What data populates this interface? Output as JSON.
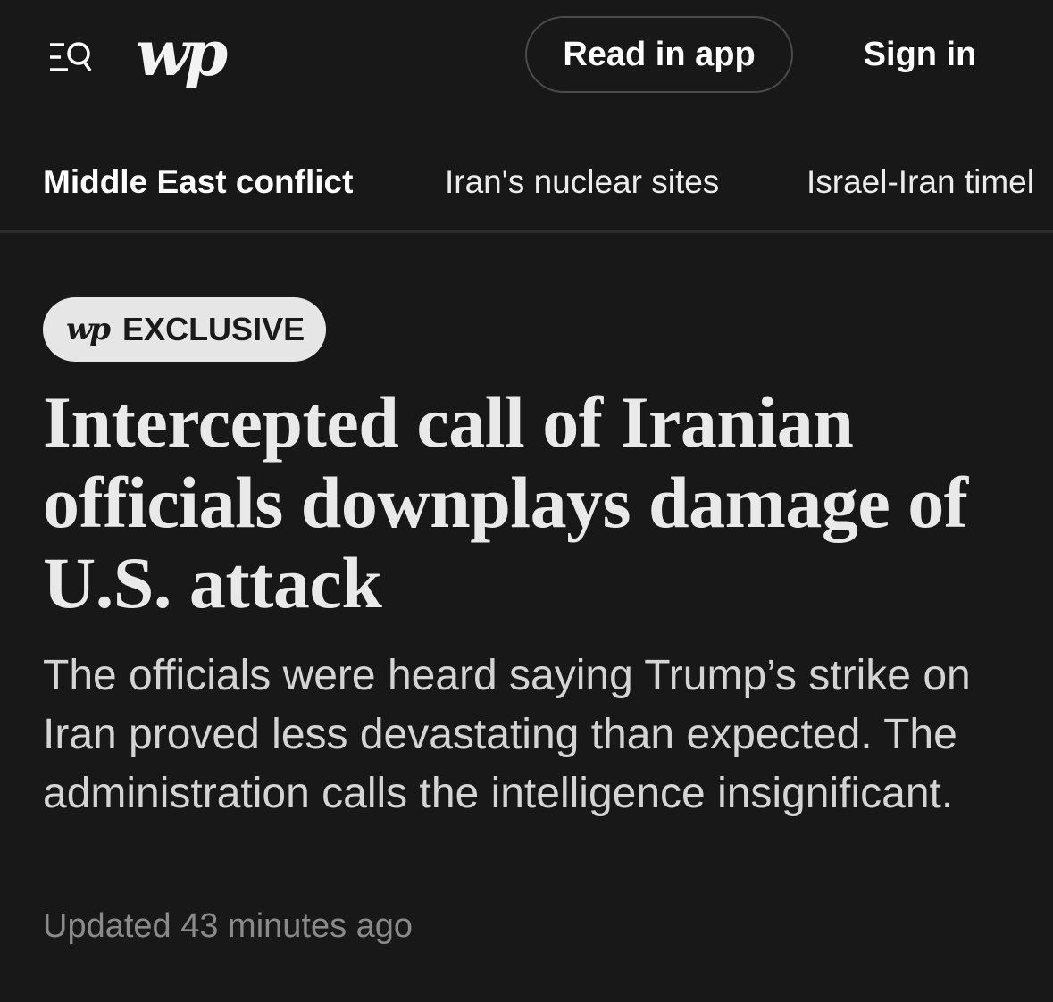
{
  "header": {
    "menu_search_icon": "menu-search-icon",
    "logo_text": "wp",
    "read_in_app_label": "Read in app",
    "sign_in_label": "Sign in"
  },
  "topic_nav": {
    "items": [
      {
        "label": "Middle East conflict",
        "active": true
      },
      {
        "label": "Iran's nuclear sites",
        "active": false
      },
      {
        "label": "Israel-Iran timel",
        "active": false
      }
    ]
  },
  "article": {
    "badge": {
      "logo_text": "wp",
      "label": "EXCLUSIVE"
    },
    "headline": "Intercepted call of Iranian officials downplays damage of U.S. attack",
    "dek": "The officials were heard saying Trump’s strike on Iran proved less devastating than expected. The administration calls the intelligence insignificant.",
    "timestamp": "Updated 43 minutes ago"
  },
  "colors": {
    "background": "#181818",
    "text_primary": "#ffffff",
    "headline": "#e9e9e9",
    "dek": "#d4d4d4",
    "timestamp": "#8a8a8a",
    "badge_bg": "#e6e6e6",
    "badge_text": "#1a1a1a",
    "divider": "#2c2c2c"
  }
}
